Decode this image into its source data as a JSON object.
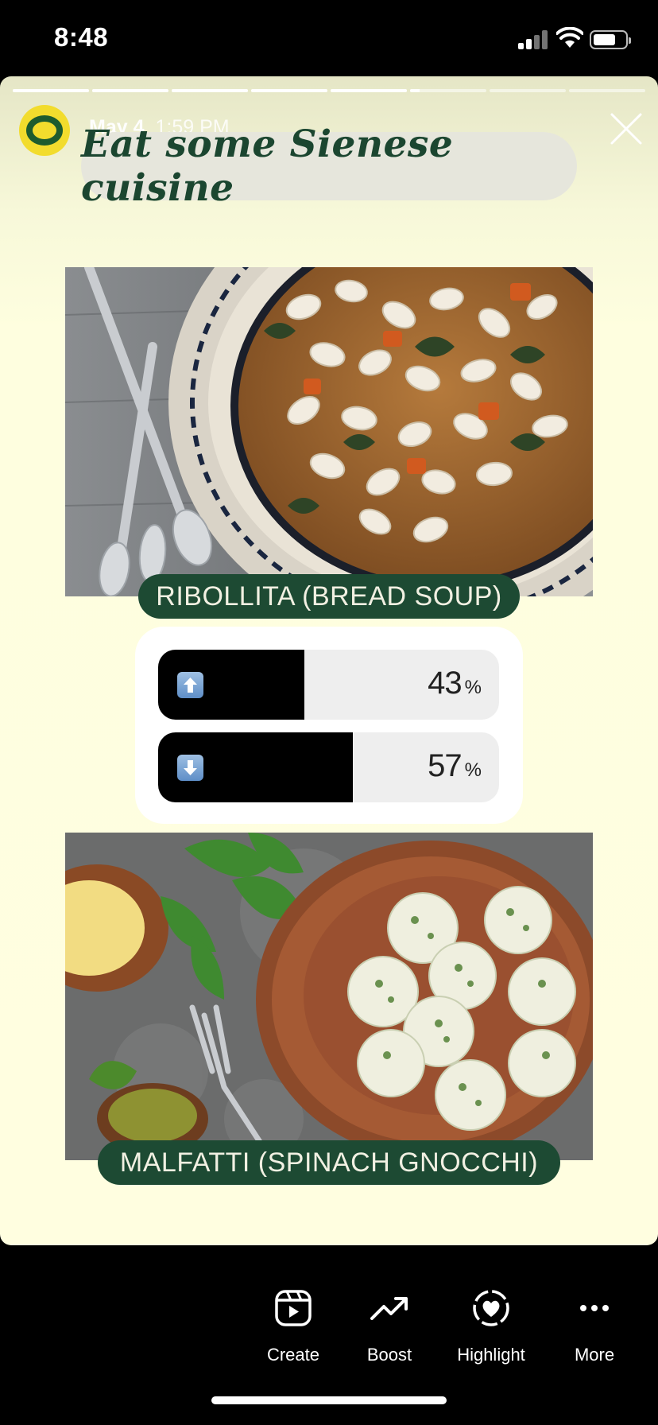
{
  "status_bar": {
    "time": "8:48",
    "battery_level": 0.72
  },
  "story": {
    "segments": [
      1,
      1,
      1,
      1,
      1,
      0.12,
      0,
      0
    ],
    "account": {
      "avatar_letter": "O",
      "avatar_color": "#f2dc2d",
      "avatar_letter_color": "#1d5c2e"
    },
    "date": "May 4",
    "time": "1:59 PM",
    "title": "Eat some Sienese cuisine",
    "dish1": {
      "label": "RIBOLLITA (BREAD SOUP)"
    },
    "dish2": {
      "label": "MALFATTI (SPINACH GNOCCHI)"
    },
    "poll": {
      "options": [
        {
          "icon": "up-arrow-icon",
          "percent": "43",
          "symbol": "%",
          "value": 0.43
        },
        {
          "icon": "down-arrow-icon",
          "percent": "57",
          "symbol": "%",
          "value": 0.57
        }
      ]
    },
    "accent_color": "#1d4a33"
  },
  "actions": [
    {
      "label": "Create",
      "icon": "reels-icon"
    },
    {
      "label": "Boost",
      "icon": "trending-up-icon"
    },
    {
      "label": "Highlight",
      "icon": "heart-circle-icon"
    },
    {
      "label": "More",
      "icon": "more-dots-icon"
    }
  ]
}
